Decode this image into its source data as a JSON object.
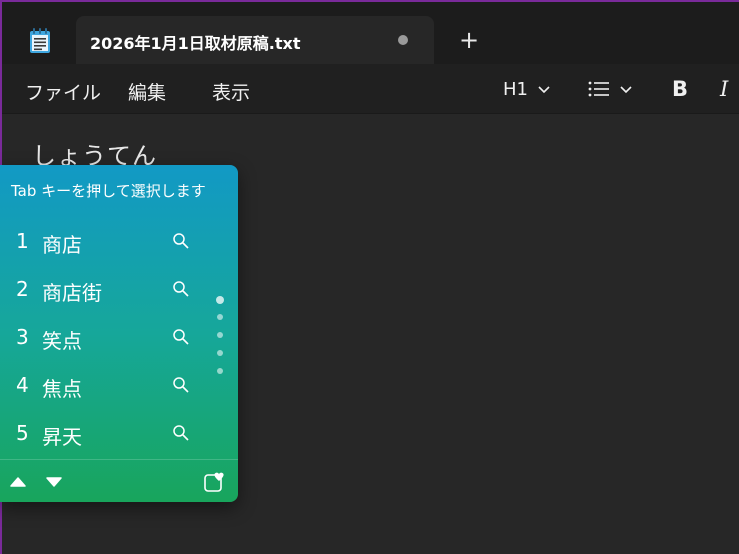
{
  "tab": {
    "title": "2026年1月1日取材原稿.txt",
    "modified_indicator": "unsaved-dot-icon",
    "new_tab_icon": "plus-icon",
    "app_icon": "notepad-icon"
  },
  "menu": {
    "file": "ファイル",
    "edit": "編集",
    "view": "表示"
  },
  "toolbar": {
    "heading_label": "H1",
    "list_icon": "bullet-list-icon",
    "bold_label": "B",
    "italic_label": "I"
  },
  "editor": {
    "composition_text": "しょうてん"
  },
  "ime": {
    "hint": "Tab キーを押して選択します",
    "candidates": [
      {
        "num": "1",
        "text": "商店"
      },
      {
        "num": "2",
        "text": "商店街"
      },
      {
        "num": "3",
        "text": "笑点"
      },
      {
        "num": "4",
        "text": "焦点"
      },
      {
        "num": "5",
        "text": "昇天"
      }
    ],
    "footer_icons": [
      "page-up-icon",
      "page-down-icon",
      "favorite-icon"
    ]
  },
  "colors": {
    "accent_border": "#7a2a9a",
    "ime_top": "#1299c5",
    "ime_bottom": "#18a55c",
    "background": "#272727"
  }
}
